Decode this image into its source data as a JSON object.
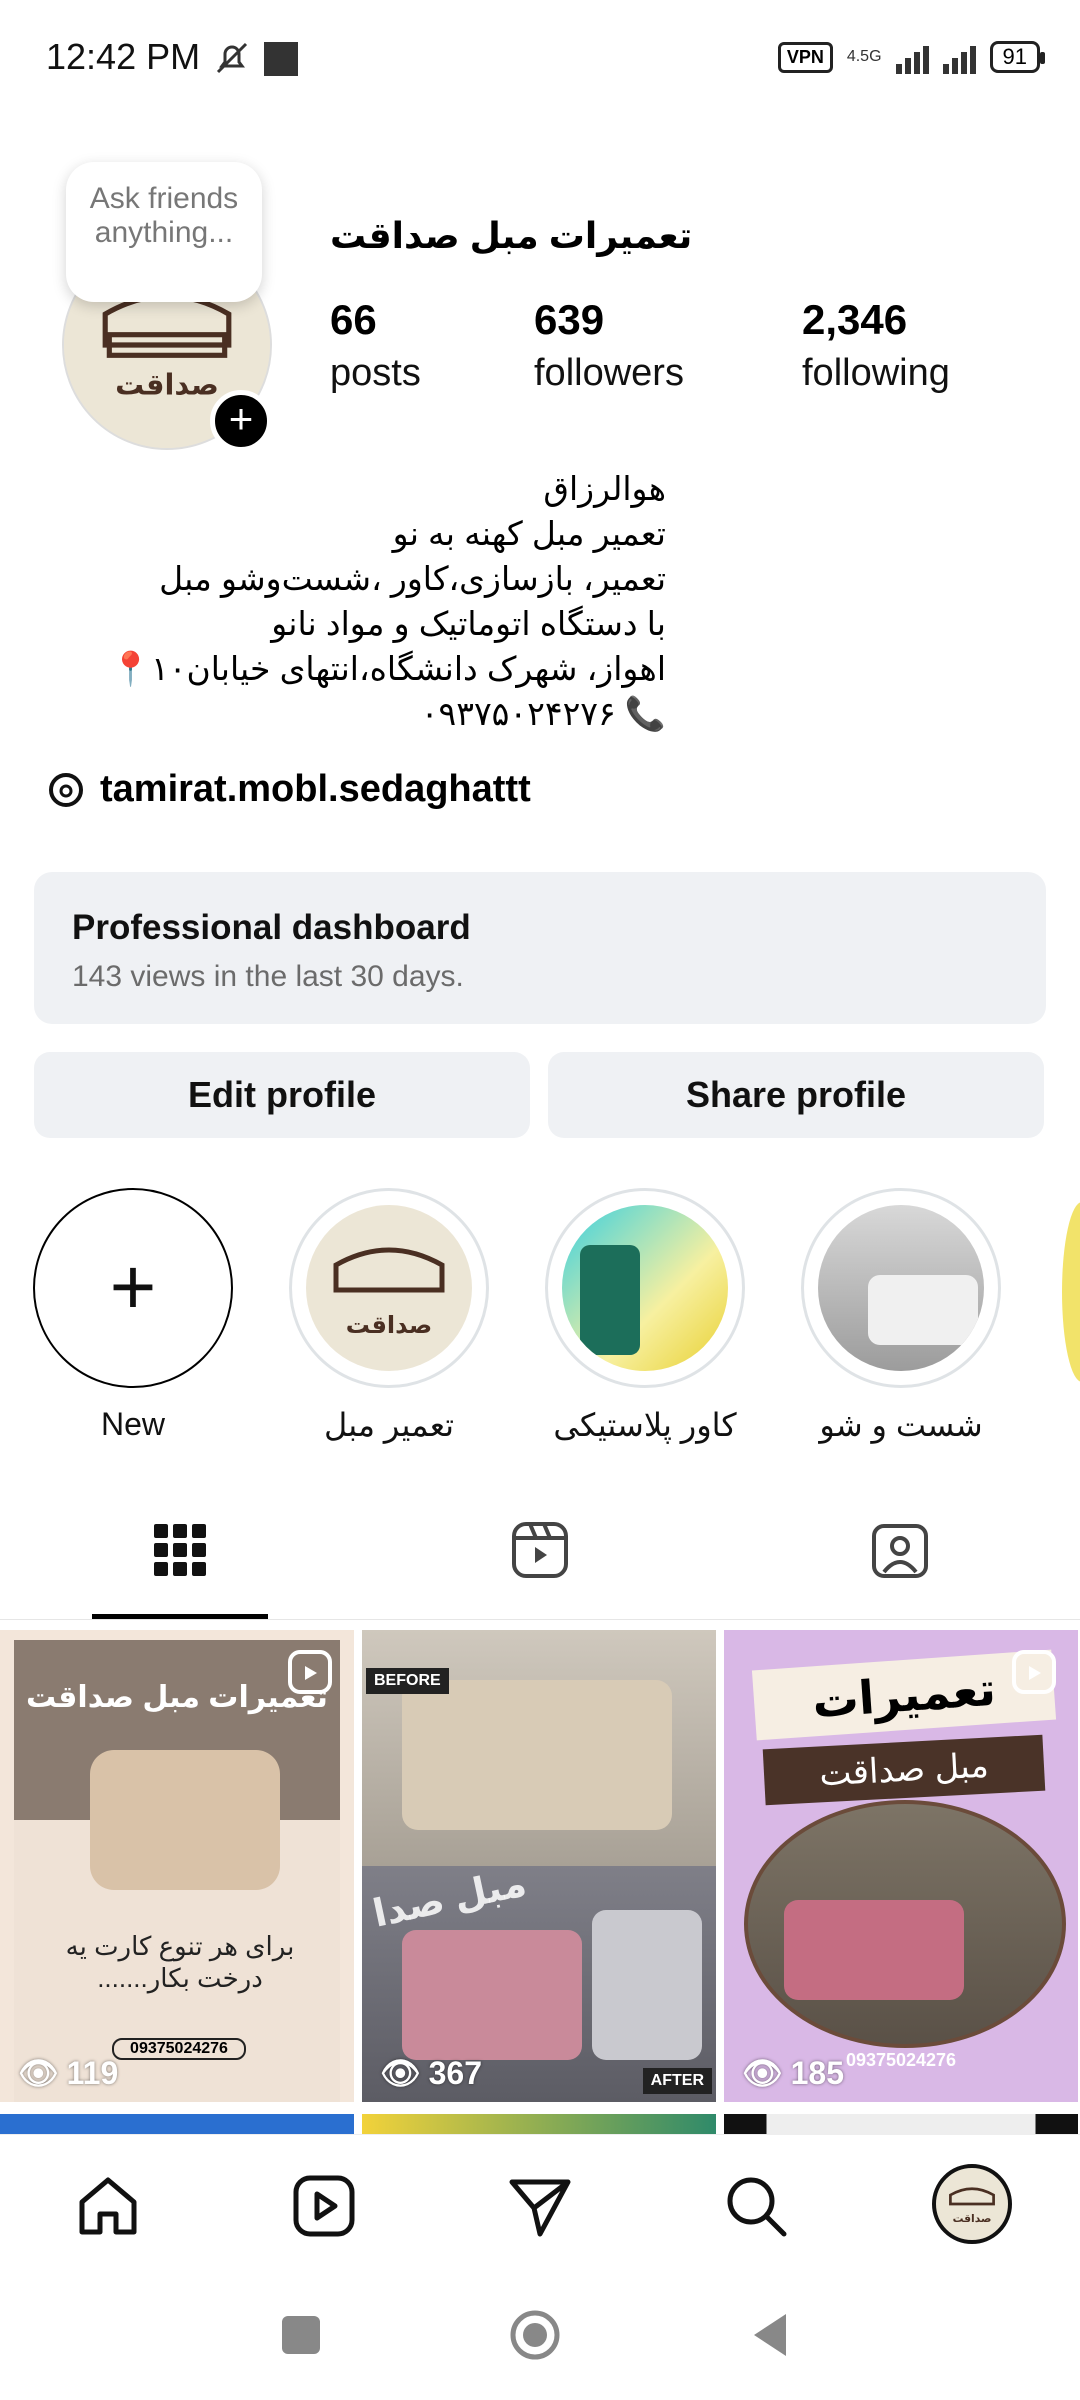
{
  "status_bar": {
    "time": "12:42 PM",
    "vpn": "VPN",
    "network": "4.5G",
    "battery": "91"
  },
  "profile": {
    "note_bubble": "Ask friends anything...",
    "name": "تعمیرات مبل  صداقت",
    "stats": [
      {
        "value": "66",
        "label": "posts"
      },
      {
        "value": "639",
        "label": "followers"
      },
      {
        "value": "2,346",
        "label": "following"
      }
    ],
    "bio_lines": [
      "هوالرزاق",
      "تعمیر مبل کهنه به نو",
      "تعمیر، بازسازی،کاور ،شست‌وشو مبل",
      "با دستگاه اتوماتیک و مواد نانو",
      "اهواز، شهرک دانشگاه،انتهای خیابان۱۰📍",
      "۰۹۳۷۵۰۲۴۲۷۶ 📞"
    ],
    "threads_handle": "tamirat.mobl.sedaghattt"
  },
  "dashboard": {
    "title": "Professional dashboard",
    "subtitle": "143 views in the last 30 days."
  },
  "buttons": {
    "edit": "Edit profile",
    "share": "Share profile"
  },
  "highlights": [
    {
      "label": "New"
    },
    {
      "label": "تعمیر مبل"
    },
    {
      "label": "کاور پلاستیکی"
    },
    {
      "label": "شست و شو"
    }
  ],
  "posts": [
    {
      "title": "تعمیرات مبل صداقت",
      "caption": "برای هر تنوع کارت یه درخت بکار.......",
      "phone": "09375024276",
      "views": "119"
    },
    {
      "tag_before": "BEFORE",
      "tag_after": "AFTER",
      "overlay": "مبل صدا",
      "views": "367"
    },
    {
      "title1": "تعمیرات",
      "title2": "مبل صداقت",
      "phone": "09375024276",
      "views": "185"
    }
  ],
  "colors": {
    "button_bg": "#eff1f4",
    "subtle_text": "#6b6b6b",
    "post1_bg": "#f3e6da",
    "post3_bg": "#d9b8e6"
  },
  "icons": [
    "silent-bell-icon",
    "threads-icon",
    "grid-icon",
    "reels-icon",
    "tagged-icon",
    "home-icon",
    "reels-nav-icon",
    "send-icon",
    "search-icon",
    "profile-avatar-icon"
  ]
}
